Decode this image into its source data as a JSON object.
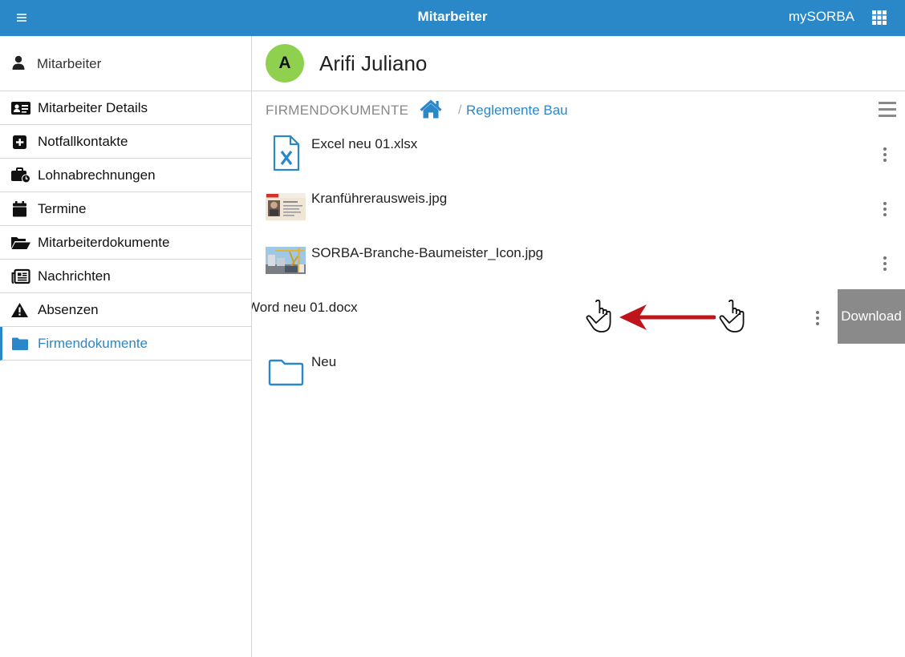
{
  "app": {
    "title": "Mitarbeiter",
    "brand": "mySORBA"
  },
  "sidebar": {
    "header": "Mitarbeiter",
    "items": [
      {
        "label": "Mitarbeiter Details",
        "icon": "id-card-icon"
      },
      {
        "label": "Notfallkontakte",
        "icon": "plus-square-icon"
      },
      {
        "label": "Lohnabrechnungen",
        "icon": "briefcase-clock-icon"
      },
      {
        "label": "Termine",
        "icon": "calendar-icon"
      },
      {
        "label": "Mitarbeiterdokumente",
        "icon": "folder-open-icon"
      },
      {
        "label": "Nachrichten",
        "icon": "newspaper-icon"
      },
      {
        "label": "Absenzen",
        "icon": "warning-icon"
      },
      {
        "label": "Firmendokumente",
        "icon": "folder-icon",
        "active": true
      }
    ]
  },
  "employee": {
    "initial": "A",
    "name": "Arifi Juliano",
    "avatar_color": "#8fd14f"
  },
  "breadcrumb": {
    "root": "FIRMENDOKUMENTE",
    "separator": "/",
    "current": "Reglemente Bau"
  },
  "files": [
    {
      "name": "Excel neu 01.xlsx",
      "type": "excel-file-icon"
    },
    {
      "name": "Kranführerausweis.jpg",
      "type": "id-card-thumbnail"
    },
    {
      "name": "SORBA-Branche-Baumeister_Icon.jpg",
      "type": "construction-thumbnail"
    },
    {
      "name": "Word neu 01.docx",
      "type": "word-file-icon",
      "swiped": true,
      "action": "Download"
    },
    {
      "name": "Neu",
      "type": "folder-icon"
    }
  ],
  "colors": {
    "accent": "#2a87c8",
    "action_bg": "#8a8a8a",
    "annotation_arrow": "#c0141b"
  }
}
